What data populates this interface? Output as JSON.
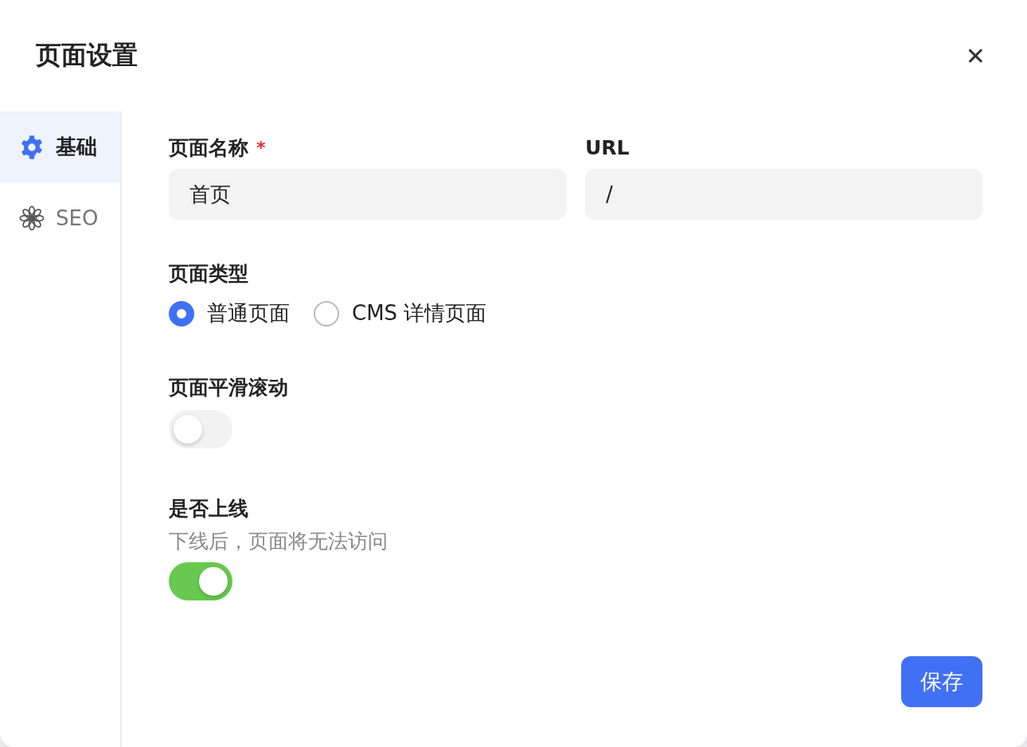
{
  "dialog": {
    "title": "页面设置",
    "close": "✕"
  },
  "sidebar": {
    "items": [
      {
        "label": "基础",
        "kind": "gear",
        "selected": true
      },
      {
        "label": "SEO",
        "kind": "flower",
        "selected": false
      }
    ]
  },
  "fields": [
    {
      "label": "页面名称",
      "required_mark": "*",
      "value": "首页"
    },
    {
      "label": "URL",
      "value": "/"
    }
  ],
  "page_type": {
    "label": "页面类型",
    "options": [
      {
        "label": "普通页面",
        "selected": true
      },
      {
        "label": "CMS 详情页面",
        "selected": false
      }
    ]
  },
  "smooth_scroll": {
    "label": "页面平滑滚动",
    "on": false
  },
  "online": {
    "label": "是否上线",
    "hint": "下线后，页面将无法访问",
    "on": true
  },
  "save_button": "保存"
}
